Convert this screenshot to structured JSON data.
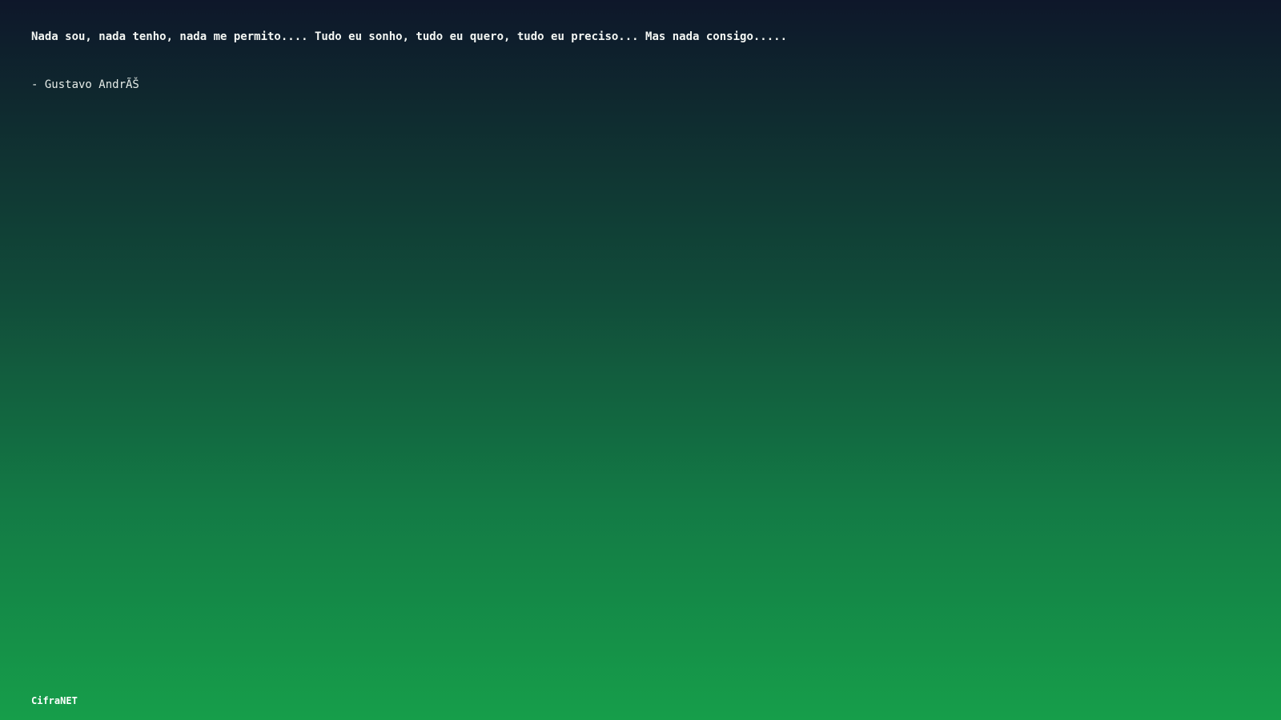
{
  "quote": {
    "text": "Nada sou, nada tenho, nada me permito.... Tudo eu sonho, tudo eu quero, tudo eu preciso... Mas nada consigo.....",
    "author": "- Gustavo AndrÃŠ"
  },
  "footer": {
    "brand": "CifraNET"
  },
  "colors": {
    "gradient_top": "#0e172a",
    "gradient_bottom": "#169e4a",
    "text": "#ffffff"
  }
}
